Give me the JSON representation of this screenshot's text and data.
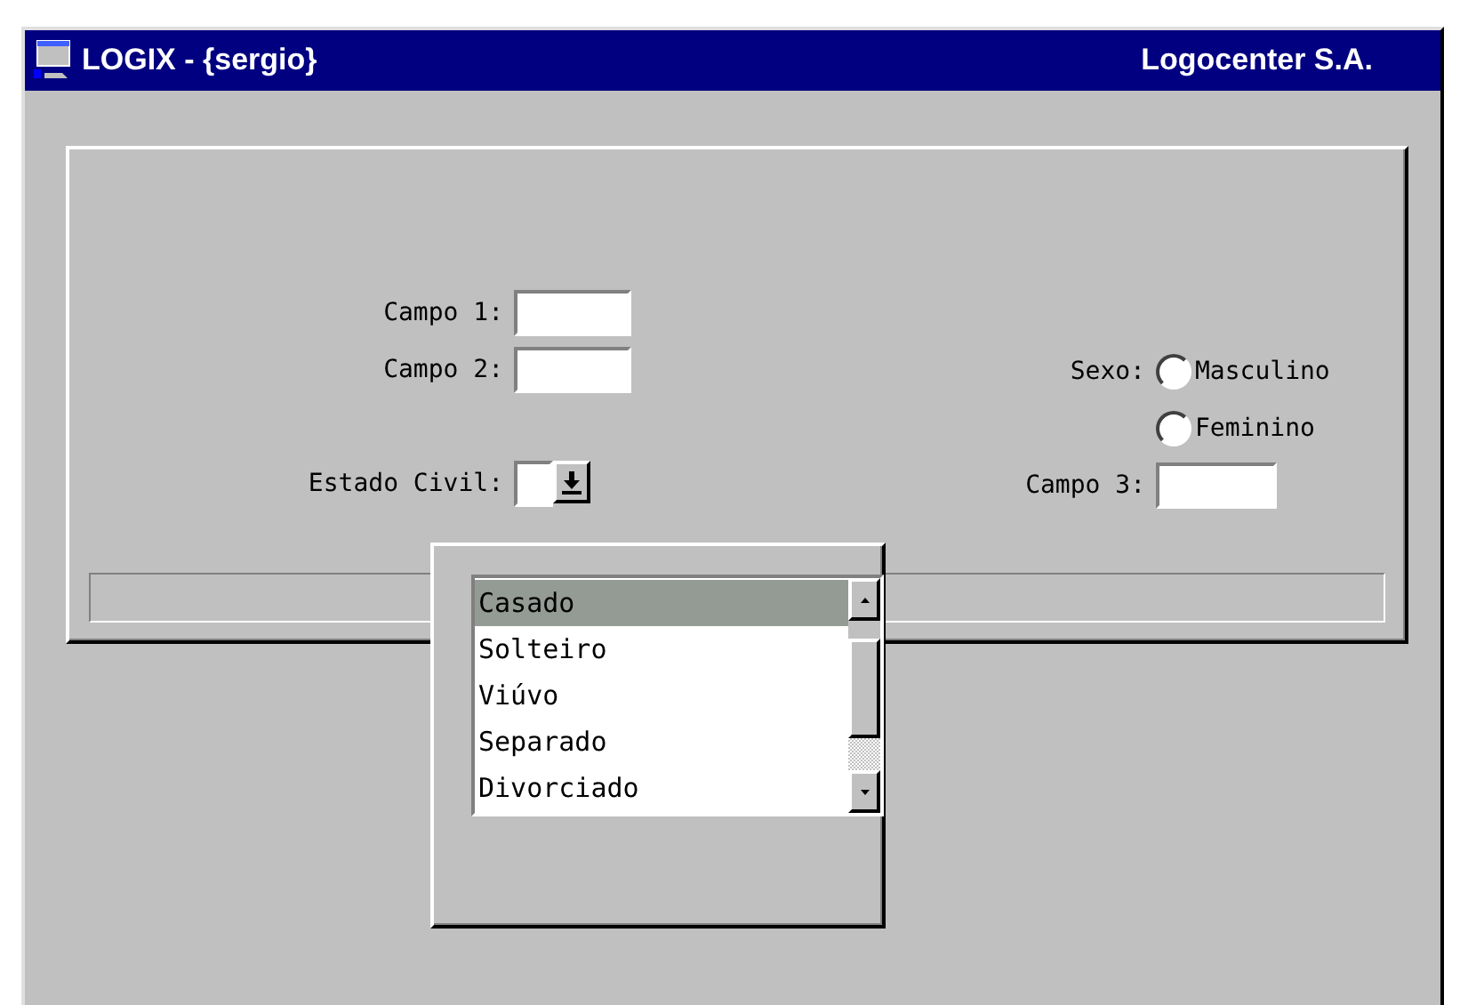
{
  "window": {
    "title": "LOGIX - {sergio}",
    "company": "Logocenter S.A."
  },
  "fields": [
    {
      "label": "Campo 1:"
    },
    {
      "label": "Campo 2:"
    }
  ],
  "estado_civil": {
    "label": "Estado Civil:",
    "options": [
      {
        "label": "Casado",
        "selected": true
      },
      {
        "label": "Solteiro",
        "selected": false
      },
      {
        "label": "Viúvo",
        "selected": false
      },
      {
        "label": "Separado",
        "selected": false
      },
      {
        "label": "Divorciado",
        "selected": false
      }
    ]
  },
  "sexo": {
    "label": "Sexo:",
    "options": [
      {
        "label": "Masculino",
        "selected": false
      },
      {
        "label": "Feminino",
        "selected": false
      }
    ]
  },
  "campo3": {
    "label": "Campo 3:"
  }
}
